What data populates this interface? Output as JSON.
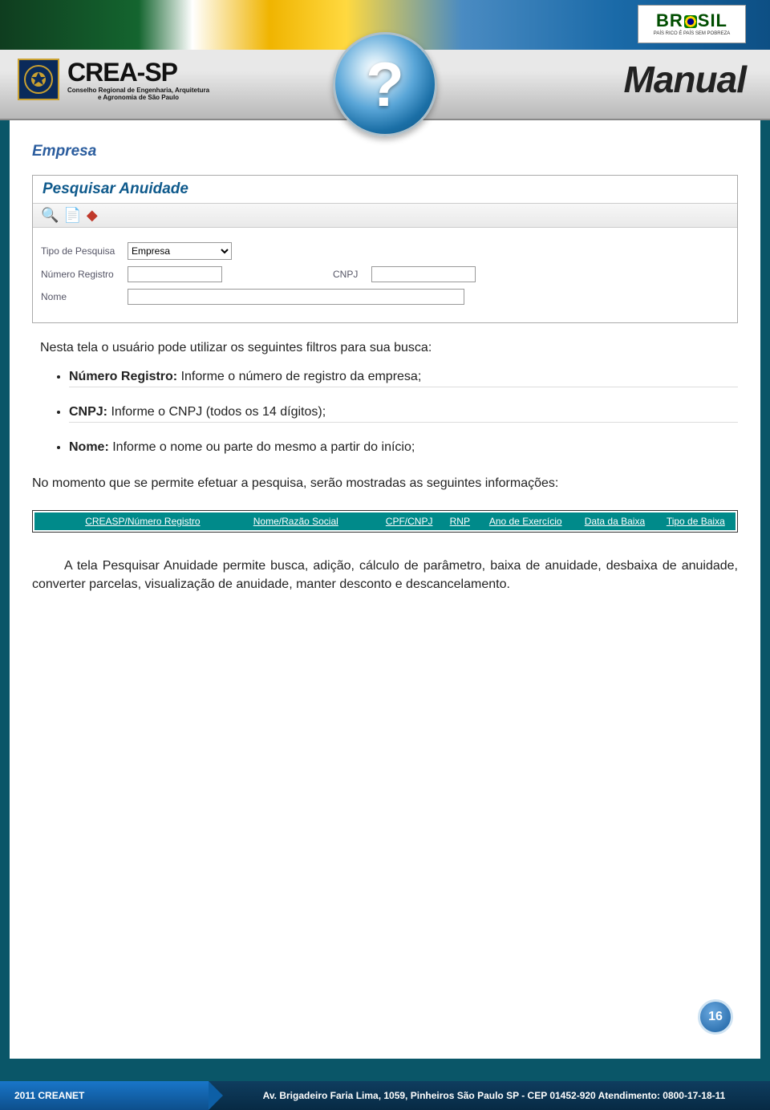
{
  "header": {
    "brasil_label": "BRASIL",
    "brasil_sub": "PAÍS RICO É PAÍS SEM POBREZA",
    "crea_main": "CREA-SP",
    "crea_sub1": "Conselho Regional de Engenharia, Arquitetura",
    "crea_sub2": "e Agronomia de São Paulo",
    "manual": "Manual",
    "question": "?"
  },
  "section": {
    "title": "Empresa"
  },
  "panel": {
    "title": "Pesquisar Anuidade",
    "toolbar": {
      "search_icon": "search-icon",
      "new_icon": "new-doc-icon",
      "eraser_icon": "eraser-icon"
    },
    "fields": {
      "tipo_label": "Tipo de Pesquisa",
      "tipo_value": "Empresa",
      "numero_label": "Número Registro",
      "numero_value": "",
      "cnpj_label": "CNPJ",
      "cnpj_value": "",
      "nome_label": "Nome",
      "nome_value": ""
    }
  },
  "text": {
    "intro": "Nesta tela o usuário pode utilizar os seguintes filtros para sua busca:",
    "filters": [
      {
        "label": "Número Registro:",
        "desc": " Informe o número de registro da empresa;"
      },
      {
        "label": "CNPJ:",
        "desc": " Informe o CNPJ (todos os 14 dígitos);"
      },
      {
        "label": "Nome:",
        "desc": " Informe o nome ou parte do mesmo a partir do início;"
      }
    ],
    "mid": "No momento que se permite efetuar a pesquisa, serão mostradas as seguintes informações:",
    "para": "A tela Pesquisar Anuidade permite busca, adição, cálculo de parâmetro, baixa de anuidade, desbaixa de anuidade, converter parcelas, visualização de anuidade, manter desconto e descancelamento."
  },
  "result_columns": [
    "CREASP/Número Registro",
    "Nome/Razão Social",
    "CPF/CNPJ",
    "RNP",
    "Ano de Exercício",
    "Data da Baixa",
    "Tipo de Baixa"
  ],
  "page_number": "16",
  "footer": {
    "left": "2011 CREANET",
    "right": "Av. Brigadeiro Faria Lima, 1059, Pinheiros São Paulo SP - CEP 01452-920 Atendimento: 0800-17-18-11"
  }
}
